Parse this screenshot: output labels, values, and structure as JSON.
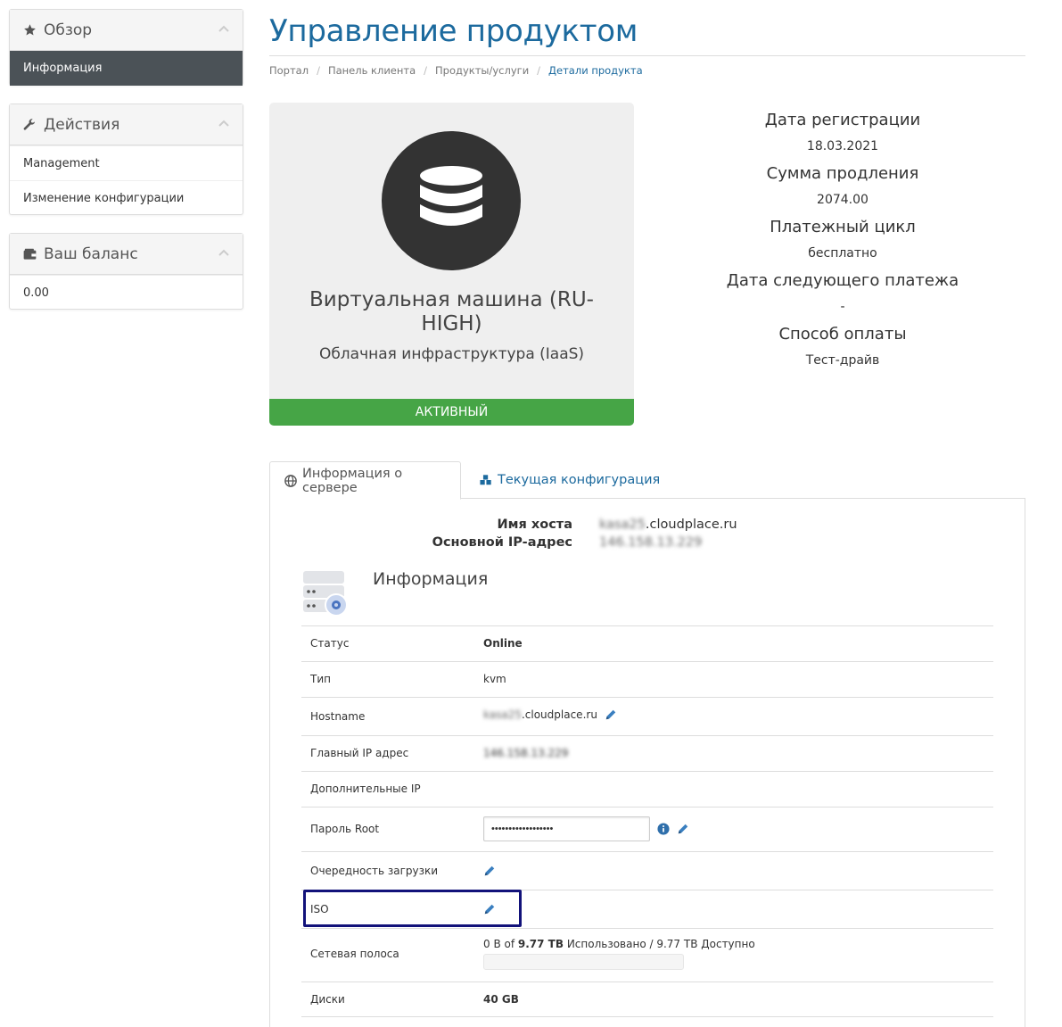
{
  "sidebar": {
    "overview": {
      "title": "Обзор",
      "items": [
        "Информация"
      ]
    },
    "actions": {
      "title": "Действия",
      "items": [
        "Management",
        "Изменение конфигурации"
      ]
    },
    "balance": {
      "title": "Ваш баланс",
      "value": "0.00"
    }
  },
  "page": {
    "title": "Управление продуктом",
    "breadcrumb": [
      "Портал",
      "Панель клиента",
      "Продукты/услуги",
      "Детали продукта"
    ]
  },
  "product": {
    "name": "Виртуальная машина (RU-HIGH)",
    "group": "Облачная инфраструктура (IaaS)",
    "status": "Активный"
  },
  "details": {
    "reg_date_label": "Дата регистрации",
    "reg_date": "18.03.2021",
    "renewal_label": "Сумма продления",
    "renewal": "2074.00",
    "cycle_label": "Платежный цикл",
    "cycle": "бесплатно",
    "next_due_label": "Дата следующего платежа",
    "next_due": "-",
    "payment_label": "Способ оплаты",
    "payment": "Тест-драйв"
  },
  "tabs": {
    "server_info": "Информация о сервере",
    "config": "Текущая конфигурация"
  },
  "server": {
    "hostname_label": "Имя хоста",
    "hostname_prefix": "kasa25",
    "hostname_domain": ".cloudplace.ru",
    "ip_label": "Основной IP-адрес",
    "ip": "146.158.13.229"
  },
  "info": {
    "title": "Информация",
    "rows": {
      "status": {
        "label": "Статус",
        "value": "Online"
      },
      "type": {
        "label": "Тип",
        "value": "kvm"
      },
      "hostname": {
        "label": "Hostname",
        "prefix": "kasa25",
        "domain": ".cloudplace.ru"
      },
      "main_ip": {
        "label": "Главный IP адрес",
        "value": "146.158.13.229"
      },
      "extra_ip": {
        "label": "Дополнительные IP",
        "value": ""
      },
      "root_pwd": {
        "label": "Пароль Root",
        "value": "••••••••••••••••••"
      },
      "boot_order": {
        "label": "Очередность загрузки"
      },
      "iso": {
        "label": "ISO"
      },
      "bandwidth": {
        "label": "Сетевая полоса",
        "used": "0 B of ",
        "total": "9.77 TB",
        "suffix": " Использовано / 9.77 TB Доступно",
        "used_fraction": 0
      },
      "disks": {
        "label": "Диски",
        "value": "40 GB"
      }
    }
  },
  "colors": {
    "accent": "#1c6a9e",
    "active_status": "#46a546",
    "online": "#2a9a2a",
    "highlight": "#12127a"
  }
}
